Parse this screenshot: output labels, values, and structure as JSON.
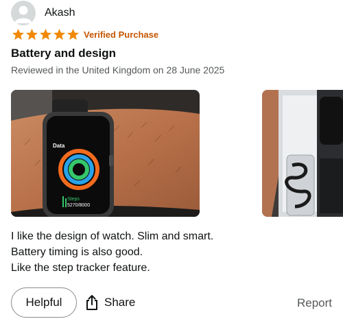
{
  "reviewer": {
    "name": "Akash",
    "avatar_icon": "default-avatar-icon"
  },
  "rating": {
    "stars": 5,
    "max": 5,
    "verified_label": "Verified Purchase",
    "star_color": "#f08804"
  },
  "review": {
    "title": "Battery and design",
    "meta": "Reviewed in the United Kingdom on 28 June 2025",
    "body_lines": [
      "I like the design of watch. Slim and smart.",
      "Battery timing is also good.",
      "Like the step tracker feature."
    ]
  },
  "photos": [
    {
      "name": "review-photo-watch-on-wrist",
      "screen": {
        "label": "Data",
        "steps_label": "Steps",
        "steps_value": "5270/8000"
      }
    },
    {
      "name": "review-photo-watch-in-box"
    }
  ],
  "actions": {
    "helpful_label": "Helpful",
    "share_label": "Share",
    "share_icon": "share-icon",
    "report_label": "Report"
  }
}
